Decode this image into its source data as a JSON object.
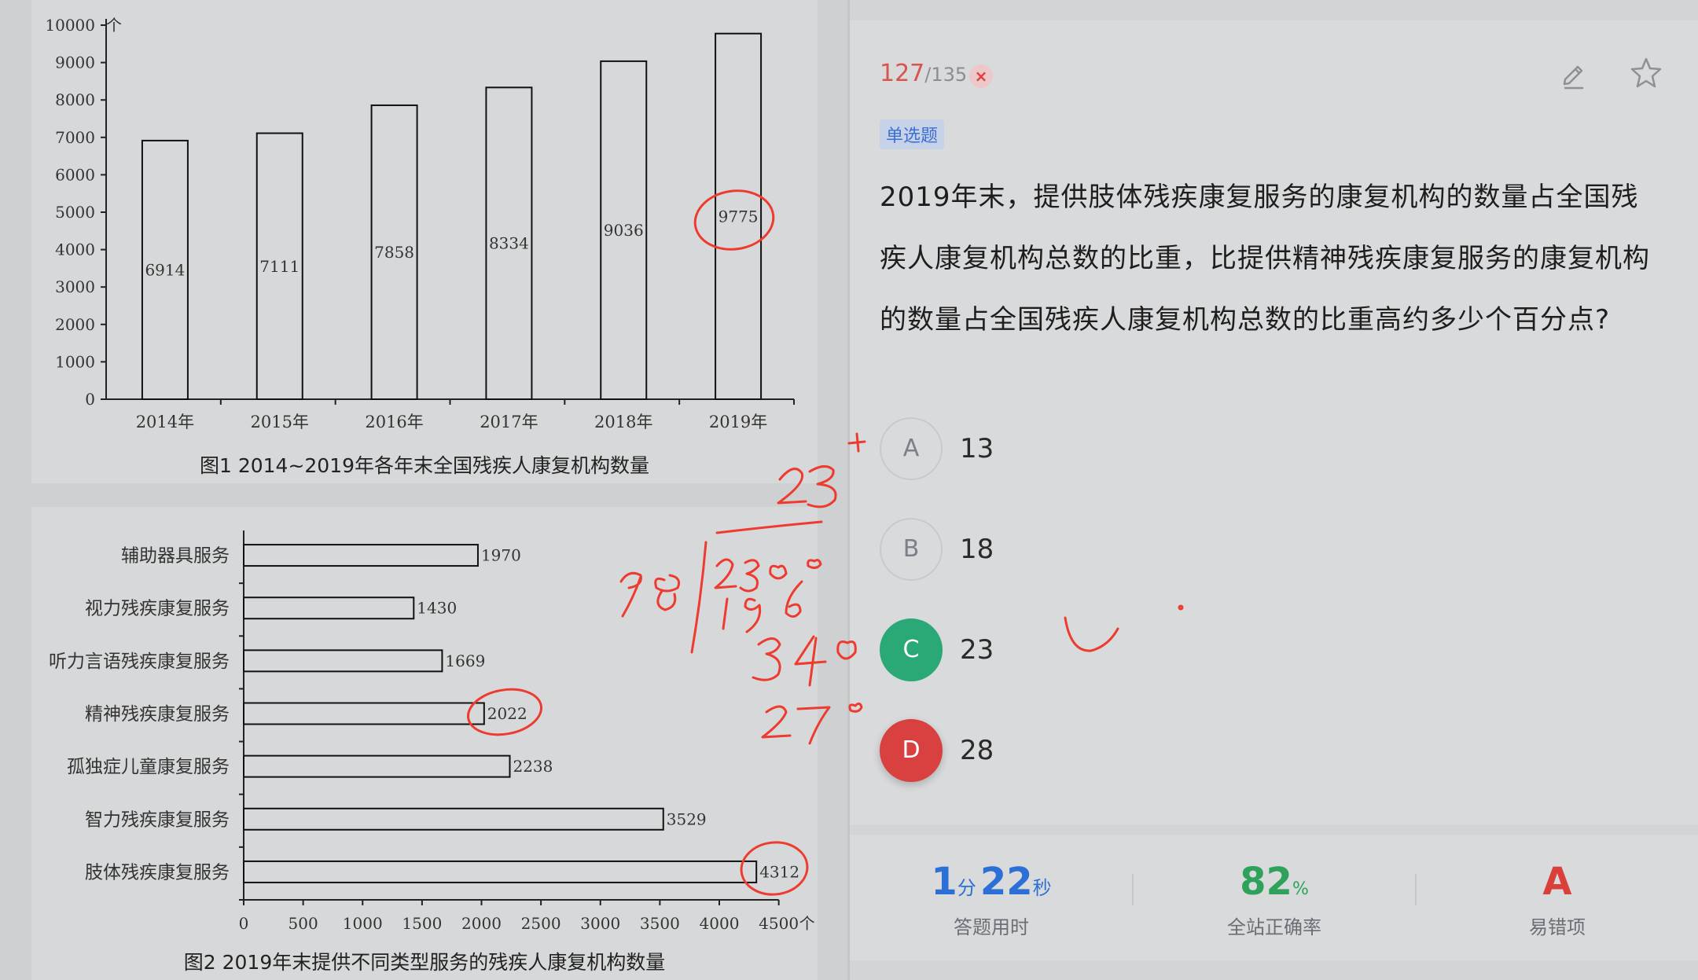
{
  "chart_data": [
    {
      "type": "bar",
      "categories": [
        "2014年",
        "2015年",
        "2016年",
        "2017年",
        "2018年",
        "2019年"
      ],
      "values": [
        6914,
        7111,
        7858,
        8334,
        9036,
        9775
      ],
      "y_ticks": [
        "0",
        "1000",
        "2000",
        "3000",
        "4000",
        "5000",
        "6000",
        "7000",
        "8000",
        "9000",
        "10000"
      ],
      "y_unit": "个",
      "ylim": [
        0,
        10000
      ],
      "title": "图1 2014~2019年各年末全国残疾人康复机构数量"
    },
    {
      "type": "bar",
      "orientation": "horizontal",
      "categories": [
        "辅助器具服务",
        "视力残疾康复服务",
        "听力言语残疾康复服务",
        "精神残疾康复服务",
        "孤独症儿童康复服务",
        "智力残疾康复服务",
        "肢体残疾康复服务"
      ],
      "values": [
        1970,
        1430,
        1669,
        2022,
        2238,
        3529,
        4312
      ],
      "x_ticks": [
        "0",
        "500",
        "1000",
        "1500",
        "2000",
        "2500",
        "3000",
        "3500",
        "4000",
        "4500"
      ],
      "x_unit": "个",
      "xlim": [
        0,
        4500
      ],
      "title": "图2 2019年末提供不同类型服务的残疾人康复机构数量"
    }
  ],
  "annotations": {
    "circled_values": [
      "9775",
      "2022",
      "4312"
    ],
    "handwriting": [
      "23",
      "+",
      "98",
      "2300",
      "196",
      "340",
      "270"
    ],
    "color": "#ee3b2f"
  },
  "question": {
    "current": "127",
    "total": "/135",
    "status_mark": "×",
    "type_label": "单选题",
    "text": "2019年末，提供肢体残疾康复服务的康复机构的数量占全国残疾人康复机构总数的比重，比提供精神残疾康复服务的康复机构的数量占全国残疾人康复机构总数的比重高约多少个百分点?",
    "edit_icon": "pencil-icon",
    "favorite_icon": "star-icon",
    "options": [
      {
        "letter": "A",
        "text": "13",
        "state": "normal"
      },
      {
        "letter": "B",
        "text": "18",
        "state": "normal"
      },
      {
        "letter": "C",
        "text": "23",
        "state": "correct"
      },
      {
        "letter": "D",
        "text": "28",
        "state": "wrong"
      }
    ]
  },
  "stats": {
    "time_minutes": "1",
    "time_min_unit": "分",
    "time_seconds": "22",
    "time_sec_unit": "秒",
    "time_label": "答题用时",
    "accuracy_value": "82",
    "accuracy_unit": "%",
    "accuracy_label": "全站正确率",
    "common_wrong_value": "A",
    "common_wrong_label": "易错项"
  },
  "colors": {
    "accent_blue": "#2c6fd6",
    "correct_green": "#2aa876",
    "wrong_red": "#d94040",
    "ink_red": "#ee3b2f"
  }
}
